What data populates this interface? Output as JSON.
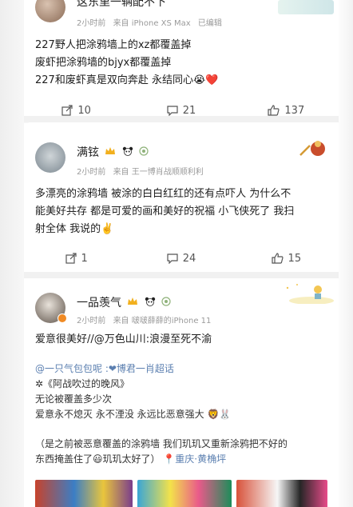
{
  "post1": {
    "author": "这东里一辆配不下",
    "time": "2小时前",
    "source": "来自 iPhone XS Max",
    "edited": "已编辑",
    "lines": [
      "227野人把涂鸦墙上的xz都覆盖掉",
      "废虾把涂鸦墙的bjyx都覆盖掉",
      "227和废虾真是双向奔赴 永结同心😭❤️"
    ],
    "reposts": "10",
    "comments": "21",
    "likes": "137"
  },
  "post2": {
    "author": "满铉",
    "time": "2小时前",
    "source": "来自 王一博肖战顺顺利利",
    "lines": [
      "多漂亮的涂鸦墙 被涂的白白红红的还有点吓人 为什么不",
      "能美好共存 都是可爱的画和美好的祝福 小飞侠死了 我扫",
      "射全体 我说的✌️"
    ],
    "reposts": "1",
    "comments": "24",
    "likes": "15"
  },
  "post3": {
    "author": "一品羡气",
    "time": "2小时前",
    "source": "来自 啵啵薛薛的iPhone 11",
    "text": "爱意很美好//@万色山川:浪漫至死不渝",
    "quote": {
      "line1": "@一只气包包呢 :",
      "line1_link": "❤博君一肖超话",
      "line2": "✲《阿战吹过的晚风》",
      "line3": "无论被覆盖多少次",
      "line4": "爱意永不熄灭 永不湮没 永远比恶意强大 🦁🐰",
      "line5": "（是之前被恶意覆盖的涂鸦墙 我们玑玑又重新涂鸦把不好的",
      "line6": "东西掩盖住了😃玑玑太好了）",
      "location": "📍重庆·黄桷坪"
    }
  },
  "colors": {
    "link": "#5b7fb0",
    "meta": "#9a9a9a",
    "heart": "#e0284a"
  },
  "icons": [
    "repost-icon",
    "comment-icon",
    "like-icon",
    "more-icon",
    "verified-icon",
    "crown-icon",
    "panda-icon",
    "location-icon"
  ]
}
